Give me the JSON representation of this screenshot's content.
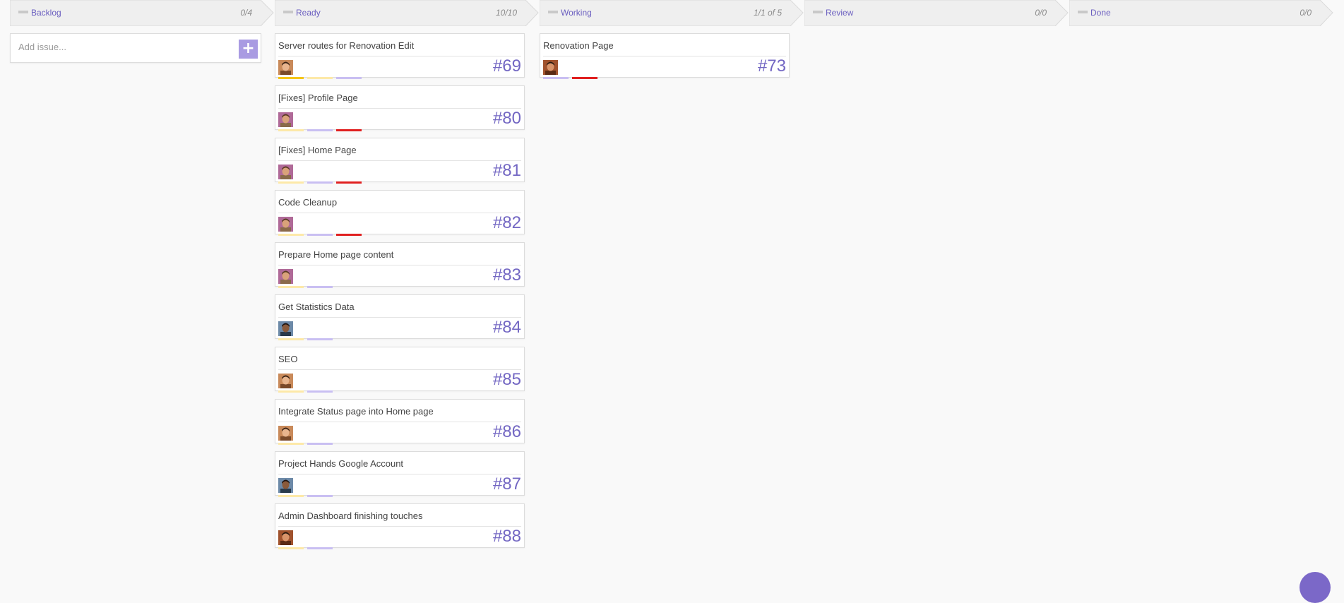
{
  "colors": {
    "accent": "#7367c3",
    "label_yellow": "#f5c518",
    "label_light_yellow": "#fde9a8",
    "label_lavender": "#c9bff2",
    "label_red": "#e02020"
  },
  "columns": [
    {
      "id": "backlog",
      "title": "Backlog",
      "count": "0/4"
    },
    {
      "id": "ready",
      "title": "Ready",
      "count": "10/10"
    },
    {
      "id": "working",
      "title": "Working",
      "count": "1/1 of 5"
    },
    {
      "id": "review",
      "title": "Review",
      "count": "0/0"
    },
    {
      "id": "done",
      "title": "Done",
      "count": "0/0"
    }
  ],
  "backlog": {
    "add_issue_placeholder": "Add issue...",
    "add_button_label": "+",
    "add_button_icon": "plus-icon"
  },
  "ready_cards": [
    {
      "title": "Server routes for Renovation Edit",
      "number": "#69",
      "avatar": "person-a",
      "labels": [
        "yellow",
        "light_yellow",
        "lavender"
      ]
    },
    {
      "title": "[Fixes] Profile Page",
      "number": "#80",
      "avatar": "person-b",
      "labels": [
        "light_yellow",
        "lavender",
        "red"
      ]
    },
    {
      "title": "[Fixes] Home Page",
      "number": "#81",
      "avatar": "person-b",
      "labels": [
        "light_yellow",
        "lavender",
        "red"
      ]
    },
    {
      "title": "Code Cleanup",
      "number": "#82",
      "avatar": "person-b",
      "labels": [
        "light_yellow",
        "lavender",
        "red"
      ]
    },
    {
      "title": "Prepare Home page content",
      "number": "#83",
      "avatar": "person-b",
      "labels": [
        "light_yellow",
        "lavender"
      ]
    },
    {
      "title": "Get Statistics Data",
      "number": "#84",
      "avatar": "person-c",
      "labels": [
        "light_yellow",
        "lavender"
      ]
    },
    {
      "title": "SEO",
      "number": "#85",
      "avatar": "person-a",
      "labels": [
        "light_yellow",
        "lavender"
      ]
    },
    {
      "title": "Integrate Status page into Home page",
      "number": "#86",
      "avatar": "person-a",
      "labels": [
        "light_yellow",
        "lavender"
      ]
    },
    {
      "title": "Project Hands Google Account",
      "number": "#87",
      "avatar": "person-c",
      "labels": [
        "light_yellow",
        "lavender"
      ]
    },
    {
      "title": "Admin Dashboard finishing touches",
      "number": "#88",
      "avatar": "person-d",
      "labels": [
        "light_yellow",
        "lavender"
      ]
    }
  ],
  "working_cards": [
    {
      "title": "Renovation Page",
      "number": "#73",
      "avatar": "person-d",
      "labels": [
        "lavender",
        "red"
      ]
    }
  ]
}
